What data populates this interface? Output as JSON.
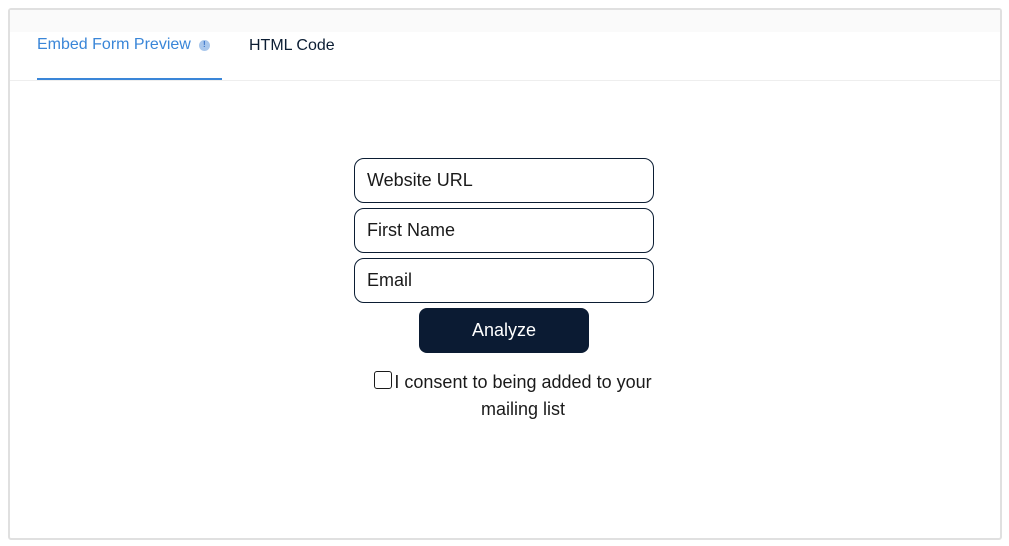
{
  "tabs": {
    "preview_label": "Embed Form Preview",
    "html_label": "HTML Code",
    "info_glyph": "!"
  },
  "form": {
    "website_placeholder": "Website URL",
    "first_name_placeholder": "First Name",
    "email_placeholder": "Email",
    "submit_label": "Analyze",
    "consent_label": "I consent to being added to your mailing list",
    "consent_checked": false
  },
  "colors": {
    "accent": "#3a86d8",
    "primary_button": "#0b1b33",
    "border": "#0b1d33"
  },
  "icons": {
    "info": "info-icon"
  }
}
